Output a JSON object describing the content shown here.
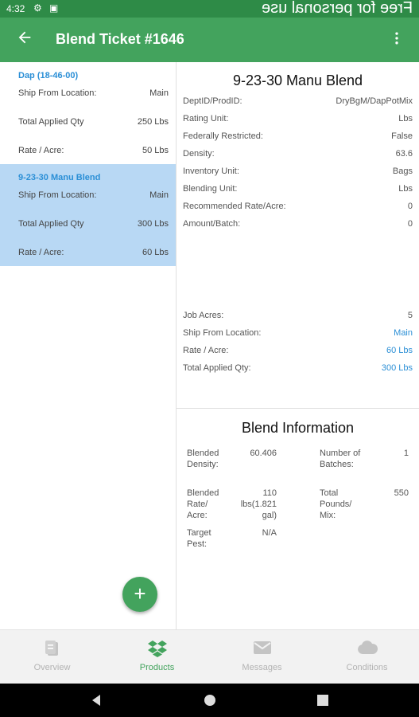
{
  "status": {
    "time": "4:32",
    "watermark": "Free for personal use",
    "icons": [
      "gear-icon",
      "square-icon"
    ]
  },
  "appbar": {
    "title": "Blend Ticket #1646",
    "back_icon": "back-arrow-icon",
    "menu_icon": "more-vert-icon"
  },
  "products": [
    {
      "name": "Dap (18-46-00)",
      "ship_label": "Ship From Location:",
      "ship_value": "Main",
      "applied_label": "Total Applied Qty",
      "applied_value": "250 Lbs",
      "rate_label": "Rate / Acre:",
      "rate_value": "50 Lbs",
      "selected": false
    },
    {
      "name": "9-23-30 Manu Blend",
      "ship_label": "Ship From Location:",
      "ship_value": "Main",
      "applied_label": "Total Applied Qty",
      "applied_value": "300 Lbs",
      "rate_label": "Rate / Acre:",
      "rate_value": "60 Lbs",
      "selected": true
    }
  ],
  "fab": {
    "label": "+"
  },
  "detail": {
    "title": "9-23-30 Manu Blend",
    "fields": [
      {
        "label": "DeptID/ProdID:",
        "value": "DryBgM/DapPotMix"
      },
      {
        "label": "Rating Unit:",
        "value": "Lbs"
      },
      {
        "label": "Federally Restricted:",
        "value": "False"
      },
      {
        "label": "Density:",
        "value": "63.6"
      },
      {
        "label": "Inventory Unit:",
        "value": "Bags"
      },
      {
        "label": "Blending Unit:",
        "value": "Lbs"
      },
      {
        "label": "Recommended Rate/Acre:",
        "value": "0"
      },
      {
        "label": "Amount/Batch:",
        "value": "0"
      }
    ],
    "job_fields": [
      {
        "label": "Job Acres:",
        "value": "5"
      },
      {
        "label": "Ship From Location:",
        "value": "Main"
      },
      {
        "label": "Rate / Acre:",
        "value": "60 Lbs"
      },
      {
        "label": "Total Applied Qty:",
        "value": "300 Lbs"
      }
    ]
  },
  "blend": {
    "title": "Blend Information",
    "blended_density_label": "Blended Density:",
    "blended_density_value": "60.406",
    "batches_label": "Number of Batches:",
    "batches_value": "1",
    "blended_rate_label": "Blended Rate/ Acre:",
    "blended_rate_value": "110 lbs(1.821 gal)",
    "total_pounds_label": "Total Pounds/ Mix:",
    "total_pounds_value": "550",
    "target_pest_label": "Target Pest:",
    "target_pest_value": "N/A"
  },
  "bottom_nav": [
    {
      "label": "Overview",
      "icon": "clipboard-icon",
      "active": false
    },
    {
      "label": "Products",
      "icon": "dropbox-icon",
      "active": true
    },
    {
      "label": "Messages",
      "icon": "mail-icon",
      "active": false
    },
    {
      "label": "Conditions",
      "icon": "cloud-icon",
      "active": false
    }
  ],
  "colors": {
    "primary": "#43a35d",
    "status_bar": "#2e8b47",
    "link": "#2b8fd6",
    "selected_bg": "#b8d8f4"
  }
}
